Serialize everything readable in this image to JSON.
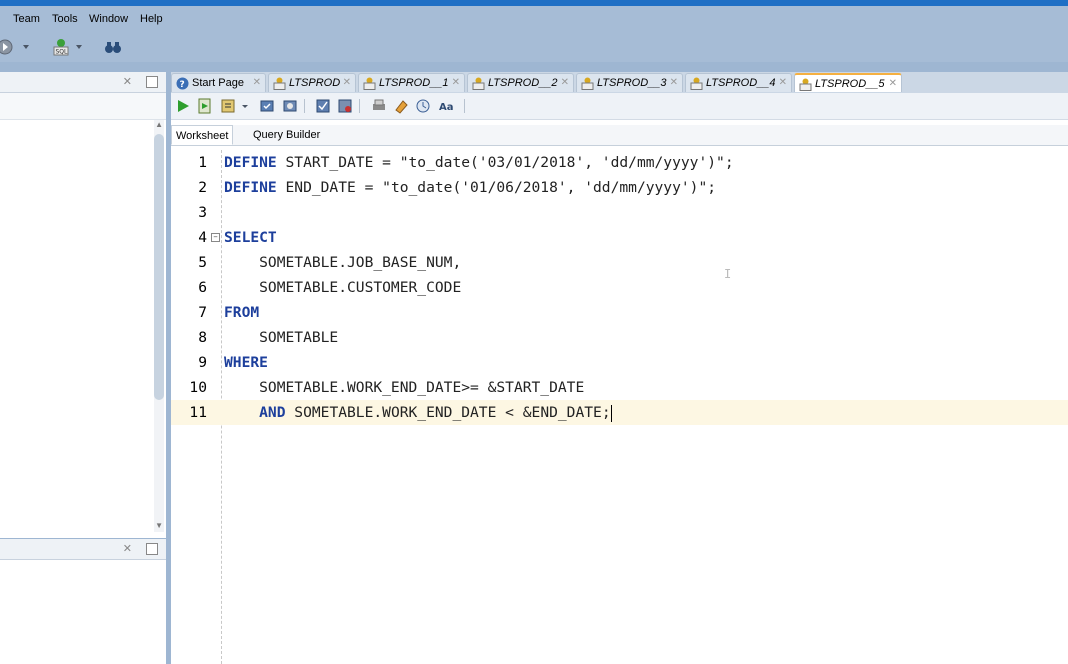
{
  "menu": [
    "Team",
    "Tools",
    "Window",
    "Help"
  ],
  "tabs": [
    {
      "label": "Start Page",
      "icon": "help-icon",
      "active": false
    },
    {
      "label": "LTSPROD",
      "icon": "sql-icon",
      "active": false
    },
    {
      "label": "LTSPROD__1",
      "icon": "sql-icon",
      "active": false
    },
    {
      "label": "LTSPROD__2",
      "icon": "sql-icon",
      "active": false
    },
    {
      "label": "LTSPROD__3",
      "icon": "sql-icon",
      "active": false
    },
    {
      "label": "LTSPROD__4",
      "icon": "sql-icon",
      "active": false
    },
    {
      "label": "LTSPROD__5",
      "icon": "sql-icon",
      "active": true
    }
  ],
  "subtabs": {
    "worksheet": "Worksheet",
    "query_builder": "Query Builder"
  },
  "editor": {
    "lines": [
      {
        "num": "1",
        "kw": "DEFINE",
        "text": " START_DATE = \"to_date('03/01/2018', 'dd/mm/yyyy')\";"
      },
      {
        "num": "2",
        "kw": "DEFINE",
        "text": " END_DATE = \"to_date('01/06/2018', 'dd/mm/yyyy')\";"
      },
      {
        "num": "3",
        "kw": "",
        "text": ""
      },
      {
        "num": "4",
        "kw": "SELECT",
        "text": ""
      },
      {
        "num": "5",
        "kw": "",
        "text": "    SOMETABLE.JOB_BASE_NUM,"
      },
      {
        "num": "6",
        "kw": "",
        "text": "    SOMETABLE.CUSTOMER_CODE"
      },
      {
        "num": "7",
        "kw": "FROM",
        "text": ""
      },
      {
        "num": "8",
        "kw": "",
        "text": "    SOMETABLE"
      },
      {
        "num": "9",
        "kw": "WHERE",
        "text": ""
      },
      {
        "num": "10",
        "kw": "",
        "text": "    SOMETABLE.WORK_END_DATE>= &START_DATE"
      },
      {
        "num": "11",
        "kw": "    AND",
        "text": " SOMETABLE.WORK_END_DATE < &END_DATE;"
      }
    ]
  },
  "colors": {
    "keyword": "#1d3f9c",
    "current_line": "#fdf7e3",
    "active_tab_accent": "#f5b041"
  }
}
